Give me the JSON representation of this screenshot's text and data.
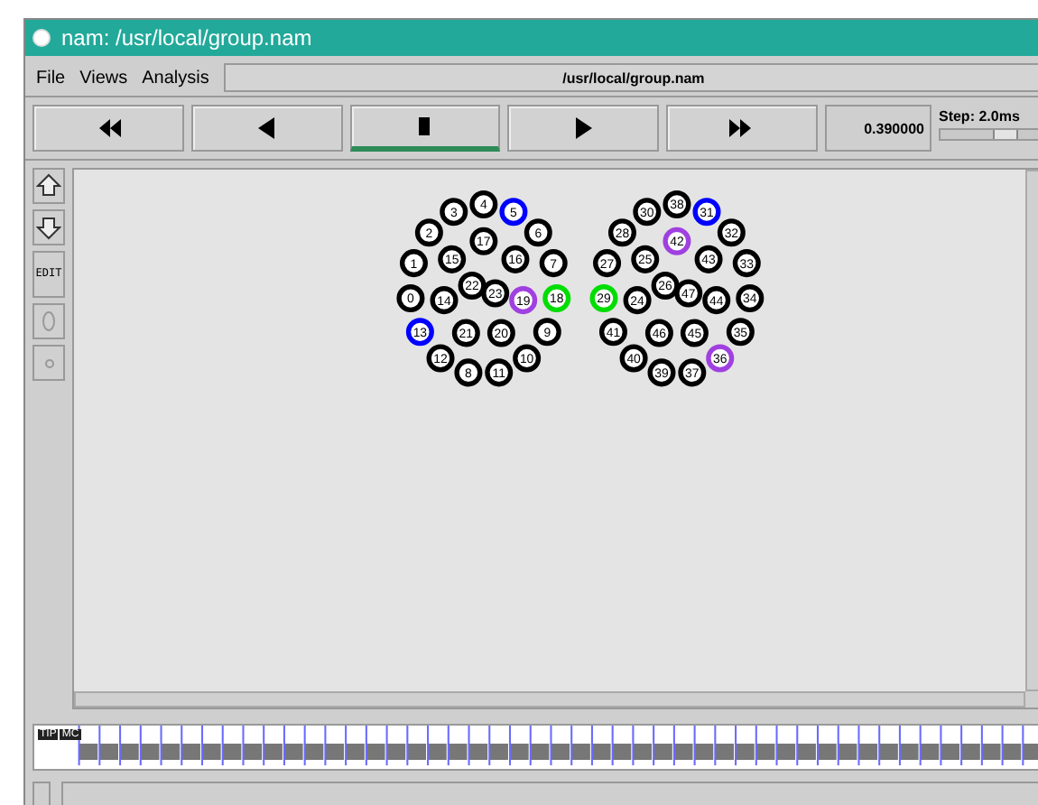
{
  "window": {
    "title": "nam: /usr/local/group.nam"
  },
  "menu": [
    {
      "label": "File"
    },
    {
      "label": "Views"
    },
    {
      "label": "Analysis"
    }
  ],
  "file_path": "/usr/local/group.nam",
  "controls": [
    {
      "kind": "rewind",
      "selected": false
    },
    {
      "kind": "back",
      "selected": false
    },
    {
      "kind": "stop",
      "selected": true
    },
    {
      "kind": "play",
      "selected": false
    },
    {
      "kind": "forward",
      "selected": false
    }
  ],
  "time": "0.390000",
  "step": {
    "label": "Step: 2.0ms",
    "level": 0.65
  },
  "tools": [
    {
      "kind": "zoom_in"
    },
    {
      "kind": "zoom_out"
    },
    {
      "kind": "edit",
      "label": "EDIT"
    },
    {
      "kind": "oval"
    },
    {
      "kind": "dot"
    }
  ],
  "clusters": [
    {
      "outer": [
        {
          "label": "4",
          "color": "#000000"
        },
        {
          "label": "5",
          "color": "#0000ff"
        },
        {
          "label": "6",
          "color": "#000000"
        },
        {
          "label": "7",
          "color": "#000000"
        },
        {
          "label": "18",
          "color": "#00dd00"
        },
        {
          "label": "9",
          "color": "#000000"
        },
        {
          "label": "10",
          "color": "#000000"
        },
        {
          "label": "11",
          "color": "#000000"
        },
        {
          "label": "8",
          "color": "#000000"
        },
        {
          "label": "12",
          "color": "#000000"
        },
        {
          "label": "13",
          "color": "#0000ff"
        },
        {
          "label": "0",
          "color": "#000000"
        },
        {
          "label": "1",
          "color": "#000000"
        },
        {
          "label": "2",
          "color": "#000000"
        },
        {
          "label": "3",
          "color": "#000000"
        }
      ],
      "inner": [
        {
          "label": "17",
          "color": "#000000"
        },
        {
          "label": "16",
          "color": "#000000"
        },
        {
          "label": "19",
          "color": "#a040e0"
        },
        {
          "label": "20",
          "color": "#000000"
        },
        {
          "label": "21",
          "color": "#000000"
        },
        {
          "label": "14",
          "color": "#000000"
        },
        {
          "label": "15",
          "color": "#000000"
        }
      ],
      "center": [
        {
          "label": "22",
          "color": "#000000"
        },
        {
          "label": "23",
          "color": "#000000"
        }
      ]
    },
    {
      "outer": [
        {
          "label": "38",
          "color": "#000000"
        },
        {
          "label": "31",
          "color": "#0000ff"
        },
        {
          "label": "32",
          "color": "#000000"
        },
        {
          "label": "33",
          "color": "#000000"
        },
        {
          "label": "34",
          "color": "#000000"
        },
        {
          "label": "35",
          "color": "#000000"
        },
        {
          "label": "36",
          "color": "#a040e0"
        },
        {
          "label": "37",
          "color": "#000000"
        },
        {
          "label": "39",
          "color": "#000000"
        },
        {
          "label": "40",
          "color": "#000000"
        },
        {
          "label": "41",
          "color": "#000000"
        },
        {
          "label": "29",
          "color": "#00dd00"
        },
        {
          "label": "27",
          "color": "#000000"
        },
        {
          "label": "28",
          "color": "#000000"
        },
        {
          "label": "30",
          "color": "#000000"
        }
      ],
      "inner": [
        {
          "label": "42",
          "color": "#a040e0"
        },
        {
          "label": "43",
          "color": "#000000"
        },
        {
          "label": "44",
          "color": "#000000"
        },
        {
          "label": "45",
          "color": "#000000"
        },
        {
          "label": "46",
          "color": "#000000"
        },
        {
          "label": "24",
          "color": "#000000"
        },
        {
          "label": "25",
          "color": "#000000"
        }
      ],
      "center": [
        {
          "label": "26",
          "color": "#000000"
        },
        {
          "label": "47",
          "color": "#000000"
        }
      ]
    }
  ],
  "timeline": {
    "labels": [
      "TIP",
      "MC"
    ]
  }
}
